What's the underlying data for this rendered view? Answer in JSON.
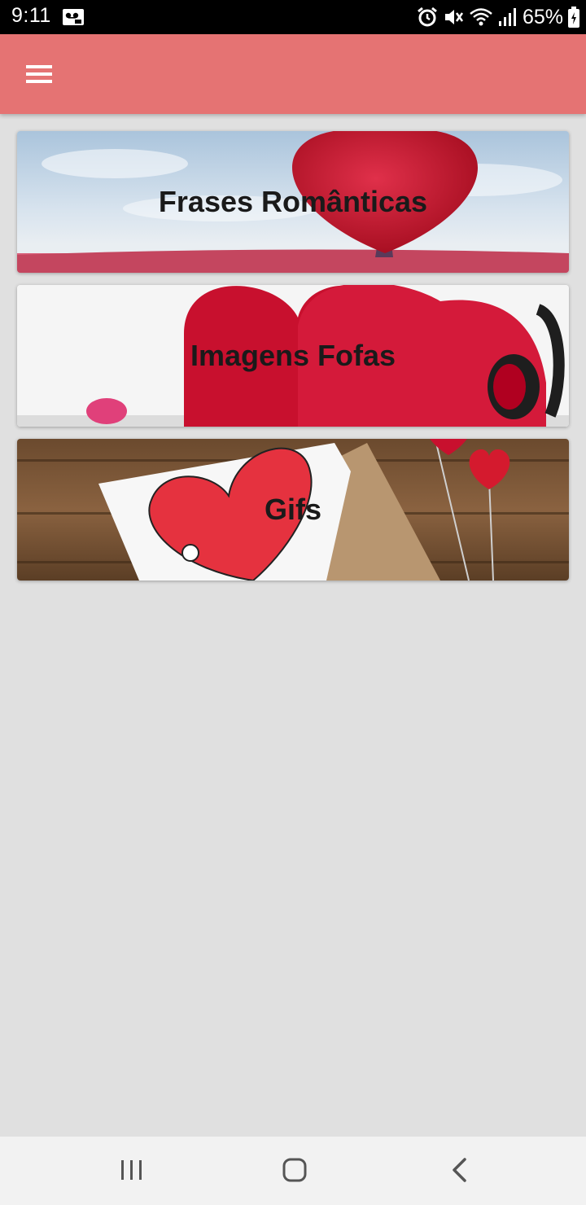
{
  "status_bar": {
    "time": "9:11",
    "battery": "65%",
    "icons": [
      "voicemail-icon",
      "alarm-icon",
      "mute-icon",
      "wifi-icon",
      "signal-icon",
      "battery-icon"
    ]
  },
  "toolbar": {
    "icon": "menu-icon"
  },
  "cards": [
    {
      "label": "Frases Românticas",
      "image": "red-heart-tree"
    },
    {
      "label": "Imagens Fofas",
      "image": "red-hearts-headphones"
    },
    {
      "label": "Gifs",
      "image": "heart-card-on-wood"
    }
  ],
  "nav_bar": {
    "icons": [
      "recents-icon",
      "home-icon",
      "back-icon"
    ]
  },
  "colors": {
    "toolbar": "#e57373",
    "background": "#e0e0e0",
    "status_bar": "#000000",
    "nav_bar": "#f2f2f2"
  }
}
